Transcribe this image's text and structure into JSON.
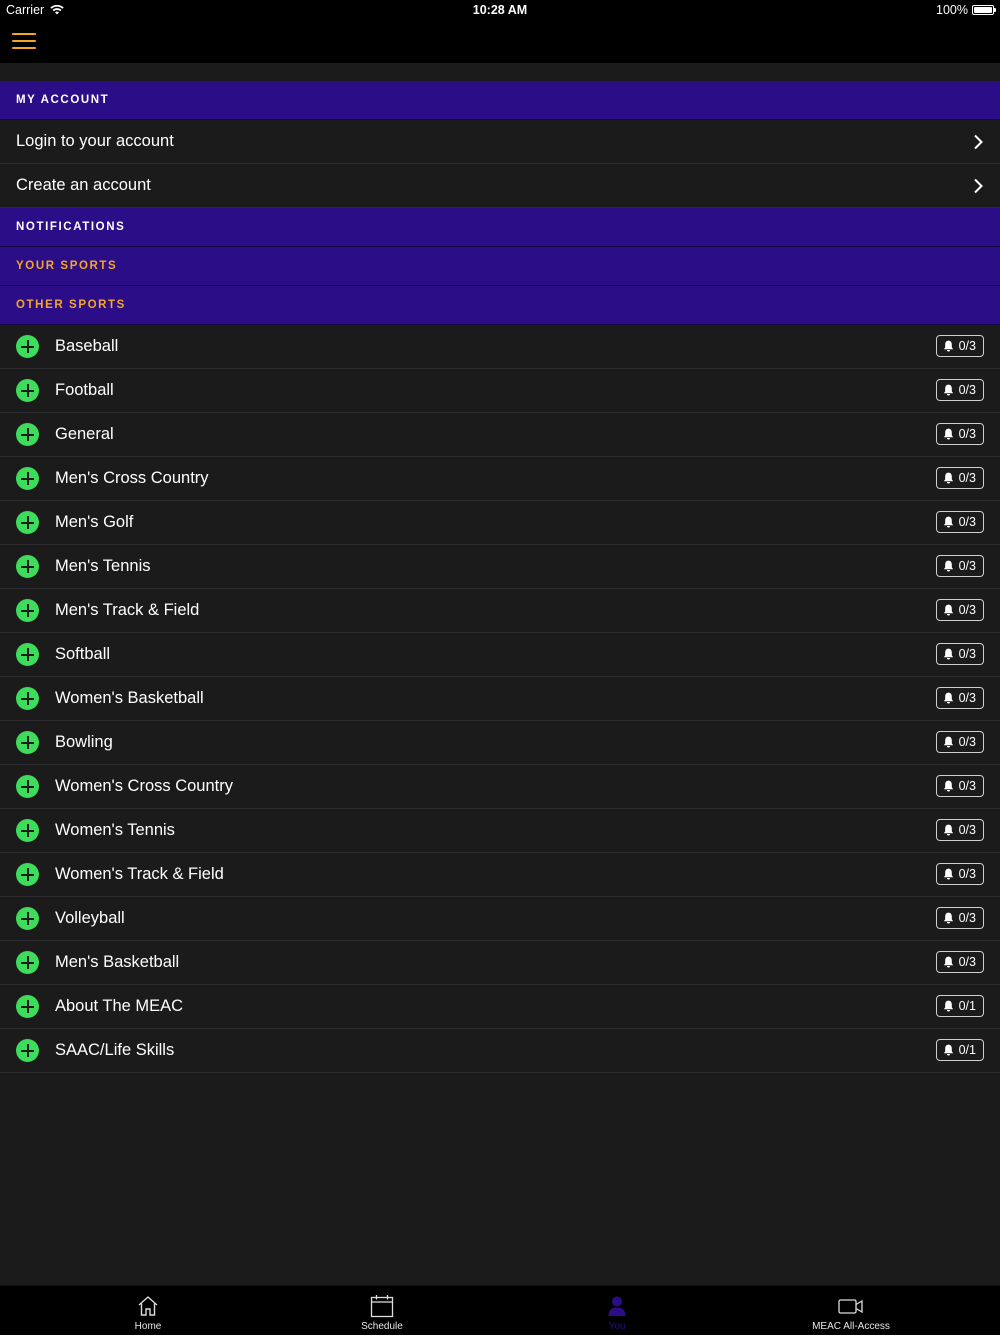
{
  "status_bar": {
    "carrier": "Carrier",
    "time": "10:28 AM",
    "battery": "100%"
  },
  "nav_bar": {
    "menu_icon": "hamburger-menu-icon"
  },
  "colors": {
    "header_bg": "#2c0d88",
    "accent_gold": "#f5a623",
    "add_green": "#3ddc5b",
    "background": "#1b1b1b"
  },
  "sections": {
    "my_account": "MY ACCOUNT",
    "notifications": "NOTIFICATIONS",
    "your_sports": "YOUR SPORTS",
    "other_sports": "OTHER SPORTS"
  },
  "account_rows": [
    {
      "label": "Login to your account"
    },
    {
      "label": "Create an account"
    }
  ],
  "sports": [
    {
      "name": "Baseball",
      "count": "0/3"
    },
    {
      "name": "Football",
      "count": "0/3"
    },
    {
      "name": "General",
      "count": "0/3"
    },
    {
      "name": "Men's Cross Country",
      "count": "0/3"
    },
    {
      "name": "Men's Golf",
      "count": "0/3"
    },
    {
      "name": "Men's Tennis",
      "count": "0/3"
    },
    {
      "name": "Men's Track & Field",
      "count": "0/3"
    },
    {
      "name": "Softball",
      "count": "0/3"
    },
    {
      "name": "Women's Basketball",
      "count": "0/3"
    },
    {
      "name": "Bowling",
      "count": "0/3"
    },
    {
      "name": "Women's Cross Country",
      "count": "0/3"
    },
    {
      "name": "Women's Tennis",
      "count": "0/3"
    },
    {
      "name": "Women's Track & Field",
      "count": "0/3"
    },
    {
      "name": "Volleyball",
      "count": "0/3"
    },
    {
      "name": "Men's Basketball",
      "count": "0/3"
    },
    {
      "name": "About The MEAC",
      "count": "0/1"
    },
    {
      "name": "SAAC/Life Skills",
      "count": "0/1"
    }
  ],
  "tabs": [
    {
      "label": "Home",
      "icon": "home-icon",
      "active": false
    },
    {
      "label": "Schedule",
      "icon": "calendar-icon",
      "active": false
    },
    {
      "label": "You",
      "icon": "person-icon",
      "active": true
    },
    {
      "label": "MEAC All-Access",
      "icon": "video-camera-icon",
      "active": false
    }
  ]
}
